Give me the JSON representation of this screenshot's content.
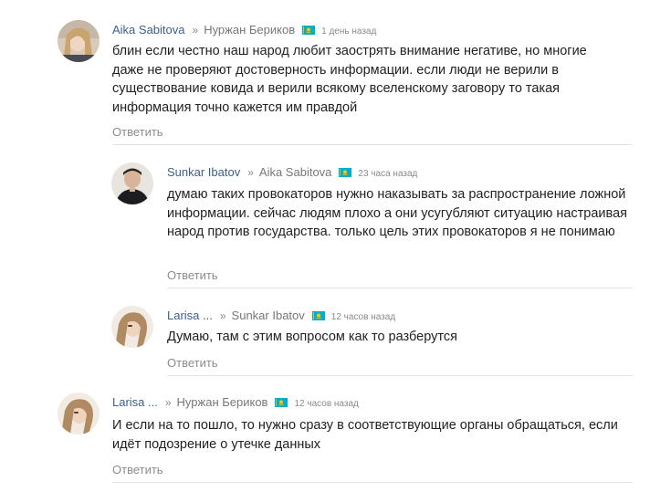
{
  "comments": [
    {
      "author": "Aika Sabitova",
      "reply_to": "Нуржан Бериков",
      "time": "1 день назад",
      "text": "блин если честно наш народ любит заострять внимание негативе, но многие даже не проверяют достоверность информации. если люди не верили в существование ковида и верили всякому вселенскому заговору то такая информация точно кажется им правдой",
      "reply_label": "Ответить"
    },
    {
      "author": "Sunkar Ibatov",
      "reply_to": "Aika Sabitova",
      "time": "23 часа назад",
      "text": "думаю таких провокаторов нужно наказывать за распространение ложной информации. сейчас людям плохо а они усугубляют ситуацию настраивая народ против государства. только цель этих провокаторов я не понимаю",
      "reply_label": "Ответить"
    },
    {
      "author": "Larisa ...",
      "reply_to": "Sunkar Ibatov",
      "time": "12 часов назад",
      "text": "Думаю, там с этим вопросом как то разберутся",
      "reply_label": "Ответить"
    },
    {
      "author": "Larisa ...",
      "reply_to": "Нуржан Бериков",
      "time": "12 часов назад",
      "text": "И если на то пошло, то нужно сразу в соответствующие органы обращаться, если идёт подозрение о утечке данных",
      "reply_label": "Ответить"
    }
  ],
  "separator": "»",
  "flag_icon": "kazakhstan-flag-icon",
  "colors": {
    "author": "#3b5f8f",
    "muted": "#8c8c8c",
    "flag_blue": "#00afca",
    "flag_gold": "#fec50c"
  }
}
